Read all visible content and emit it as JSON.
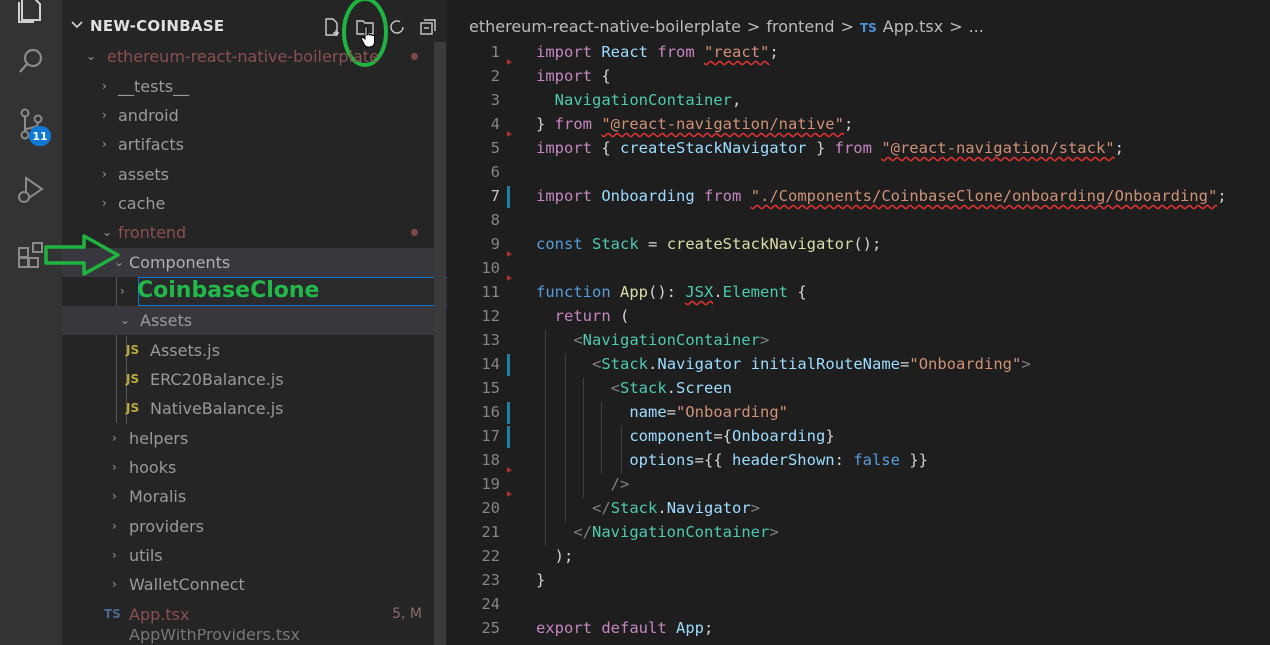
{
  "explorer": {
    "title": "NEW-COINBASE",
    "root_folder": "ethereum-react-native-boilerplate",
    "tree": [
      {
        "label": "__tests__"
      },
      {
        "label": "android"
      },
      {
        "label": "artifacts"
      },
      {
        "label": "assets"
      },
      {
        "label": "cache"
      },
      {
        "label": "frontend"
      },
      {
        "label": "Components"
      },
      {
        "label": "CoinbaseClone"
      },
      {
        "label": "Assets"
      },
      {
        "label": "Assets.js"
      },
      {
        "label": "ERC20Balance.js"
      },
      {
        "label": "NativeBalance.js"
      },
      {
        "label": "helpers"
      },
      {
        "label": "hooks"
      },
      {
        "label": "Moralis"
      },
      {
        "label": "providers"
      },
      {
        "label": "utils"
      },
      {
        "label": "WalletConnect"
      },
      {
        "label": "App.tsx",
        "status": "5, M"
      },
      {
        "label": "AppWithProviders.tsx"
      }
    ],
    "js_badge": "JS",
    "source_control_badge": "11"
  },
  "breadcrumb": {
    "project": "ethereum-react-native-boilerplate",
    "sep": ">",
    "folder": "frontend",
    "file_icon": "TS",
    "file": "App.tsx",
    "more": "..."
  },
  "editor": {
    "line_numbers": [
      "1",
      "2",
      "3",
      "4",
      "5",
      "6",
      "7",
      "8",
      "9",
      "10",
      "11",
      "12",
      "13",
      "14",
      "15",
      "16",
      "17",
      "18",
      "19",
      "20",
      "21",
      "22",
      "23",
      "24",
      "25"
    ],
    "lines": [
      "import React from \"react\";",
      "import {",
      "  NavigationContainer,",
      "} from \"@react-navigation/native\";",
      "import { createStackNavigator } from \"@react-navigation/stack\";",
      "",
      "import Onboarding from \"./Components/CoinbaseClone/onboarding/Onboarding\";",
      "",
      "const Stack = createStackNavigator();",
      "",
      "function App(): JSX.Element {",
      "  return (",
      "    <NavigationContainer>",
      "      <Stack.Navigator initialRouteName=\"Onboarding\">",
      "        <Stack.Screen",
      "          name=\"Onboarding\"",
      "          component={Onboarding}",
      "          options={{ headerShown: false }}",
      "        />",
      "      </Stack.Navigator>",
      "    </NavigationContainer>",
      "  );",
      "}",
      "",
      "export default App;"
    ]
  },
  "icons": {
    "activity": [
      "explorer-icon",
      "search-icon",
      "source-control-icon",
      "run-debug-icon",
      "extensions-icon"
    ],
    "header": [
      "new-file-icon",
      "new-folder-icon",
      "refresh-icon",
      "collapse-all-icon"
    ]
  },
  "colors": {
    "annotation_green": "#22b84a",
    "selection_blue": "#0e78d5",
    "modified_red": "#8a6a6a"
  }
}
